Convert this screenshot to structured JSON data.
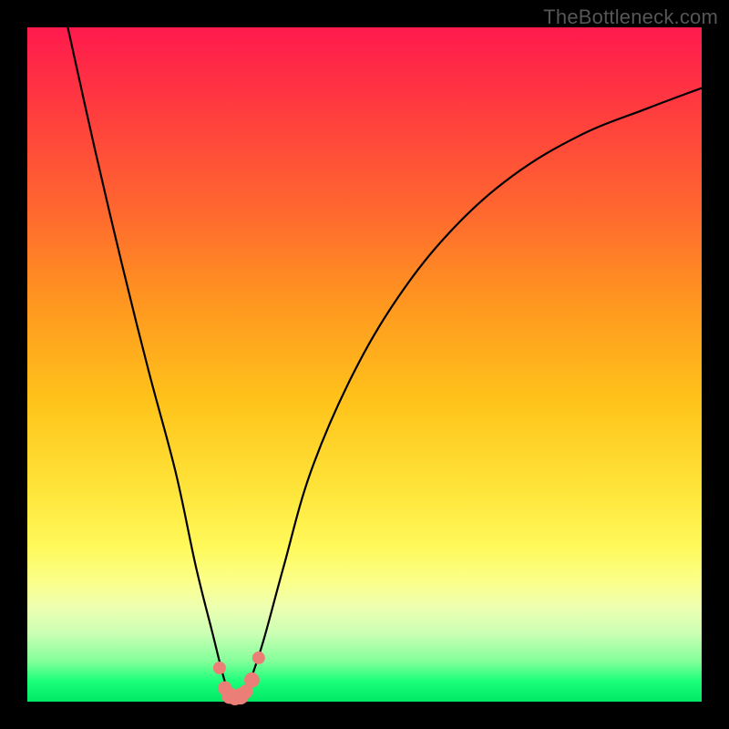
{
  "watermark": "TheBottleneck.com",
  "chart_data": {
    "type": "line",
    "title": "",
    "xlabel": "",
    "ylabel": "",
    "xlim": [
      0,
      100
    ],
    "ylim": [
      0,
      100
    ],
    "grid": false,
    "legend": false,
    "series": [
      {
        "name": "bottleneck-curve",
        "x": [
          6,
          10,
          14,
          18,
          22,
          25,
          27.5,
          29,
          30,
          31,
          32,
          33,
          35,
          38,
          42,
          48,
          55,
          63,
          72,
          82,
          92,
          100
        ],
        "values": [
          100,
          82,
          65,
          49,
          34,
          20,
          10,
          4,
          1,
          0.5,
          1,
          3,
          9,
          20,
          34,
          48,
          60,
          70,
          78,
          84,
          88,
          91
        ]
      }
    ],
    "markers": {
      "name": "highlight-dots",
      "color": "#eb7f78",
      "points": [
        {
          "x": 28.5,
          "y": 5.0,
          "r": 1.0
        },
        {
          "x": 29.3,
          "y": 2.0,
          "r": 1.1
        },
        {
          "x": 30.0,
          "y": 0.9,
          "r": 1.3
        },
        {
          "x": 30.8,
          "y": 0.6,
          "r": 1.2
        },
        {
          "x": 31.6,
          "y": 0.8,
          "r": 1.3
        },
        {
          "x": 32.4,
          "y": 1.5,
          "r": 1.1
        },
        {
          "x": 33.3,
          "y": 3.2,
          "r": 1.2
        },
        {
          "x": 34.3,
          "y": 6.5,
          "r": 1.0
        }
      ]
    }
  }
}
